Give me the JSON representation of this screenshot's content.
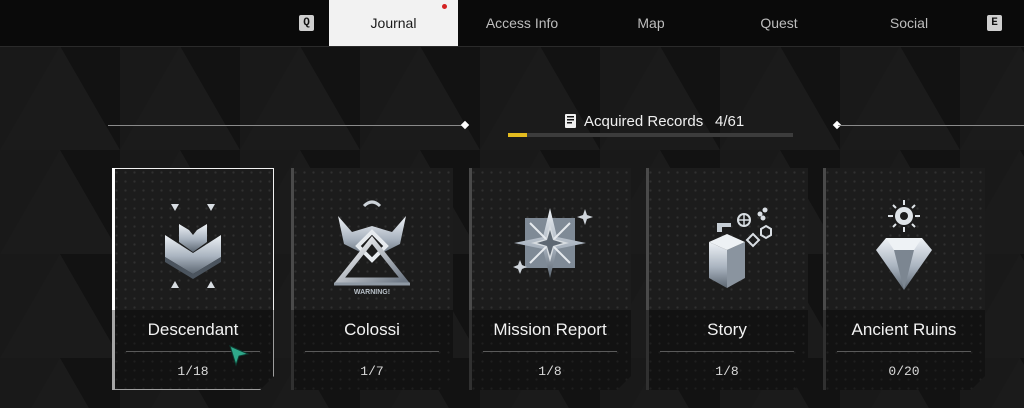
{
  "nav": {
    "prev_key": "Q",
    "next_key": "E",
    "tabs": [
      {
        "label": "Journal",
        "active": true,
        "notification": true
      },
      {
        "label": "Access Info",
        "active": false
      },
      {
        "label": "Map",
        "active": false
      },
      {
        "label": "Quest",
        "active": false
      },
      {
        "label": "Social",
        "active": false
      }
    ]
  },
  "records": {
    "icon": "record-book-icon",
    "label": "Acquired Records",
    "count": "4/61",
    "progress": 0.066,
    "progress_color": "#e3bb1f"
  },
  "cards": [
    {
      "title": "Descendant",
      "count": "1/18",
      "icon": "descendant-chevron-icon",
      "selected": true
    },
    {
      "title": "Colossi",
      "count": "1/7",
      "icon": "colossi-warning-icon",
      "icon_text": "WARNING!",
      "selected": false
    },
    {
      "title": "Mission Report",
      "count": "1/8",
      "icon": "mission-star-icon",
      "selected": false
    },
    {
      "title": "Story",
      "count": "1/8",
      "icon": "story-book-icon",
      "selected": false
    },
    {
      "title": "Ancient Ruins",
      "count": "0/20",
      "icon": "ancient-ruins-crystal-icon",
      "selected": false
    }
  ],
  "colors": {
    "background": "#141414",
    "active_tab": "#f2f2f2",
    "notification_dot": "#d42222",
    "cursor": "#2fa88a"
  }
}
